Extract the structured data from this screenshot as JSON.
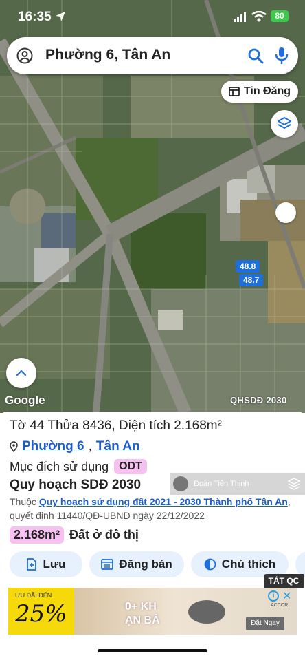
{
  "status_bar": {
    "time": "16:35",
    "battery": "80"
  },
  "search": {
    "title": "Phường 6, Tân An"
  },
  "map": {
    "tin_dang_label": "Tin Đăng",
    "tags": [
      "48.8",
      "48.7"
    ],
    "attribution": "Google",
    "layer_name": "QHSDĐ 2030"
  },
  "panel": {
    "title": "Tờ 44 Thửa 8436, Diện tích 2.168m²",
    "ward": "Phường 6",
    "separator": ",",
    "city": "Tân An",
    "purpose_label": "Mục đích sử dụng",
    "purpose_code": "ODT",
    "plan_title": "Quy hoạch SDĐ 2030",
    "overlay_user": "Đoàn Tiến Thịnh",
    "desc_prefix": "Thuộc",
    "desc_link": "Quy hoạch sử dụng đất 2021 - 2030 Thành phố Tân An",
    "desc_suffix": ", quyết định 11440/QĐ-UBND ngày 22/12/2022",
    "area": "2.168m²",
    "land_type": "Đất ở đô thị",
    "buttons": {
      "save": "Lưu",
      "sell": "Đăng bán",
      "legend": "Chú thích"
    }
  },
  "ad": {
    "close_label": "TẮT QC",
    "promo_small": "ƯU ĐÃI ĐẾN",
    "promo_pct": "25%",
    "headline_1": "0+ KH",
    "headline_2": "ẠN BẢ",
    "brand": "ACCOR",
    "cta": "Đặt Ngay"
  },
  "colors": {
    "accent": "#1e5ec8",
    "badge": "#f6c0f0",
    "pill_bg": "#e7f0fd",
    "tag": "#1e6fd9"
  }
}
